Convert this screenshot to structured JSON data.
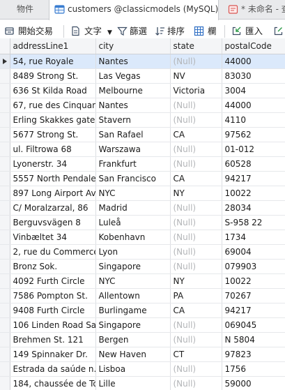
{
  "tabs": {
    "objects": "物件",
    "active": "customers @classicmodels (MySQL) - ...",
    "query": "* 未命名 - 查"
  },
  "toolbar": {
    "begin_transaction": "開始交易",
    "text": "文字",
    "filter": "篩選",
    "sort": "排序",
    "columns": "欄",
    "import": "匯入"
  },
  "table": {
    "columns": [
      "addressLine1",
      "city",
      "state",
      "postalCode"
    ],
    "rows": [
      [
        "54, rue Royale",
        "Nantes",
        "(Null)",
        "44000"
      ],
      [
        "8489 Strong St.",
        "Las Vegas",
        "NV",
        "83030"
      ],
      [
        "636 St Kilda Road",
        "Melbourne",
        "Victoria",
        "3004"
      ],
      [
        "67, rue des Cinquant",
        "Nantes",
        "(Null)",
        "44000"
      ],
      [
        "Erling Skakkes gate 7",
        "Stavern",
        "(Null)",
        "4110"
      ],
      [
        "5677 Strong St.",
        "San Rafael",
        "CA",
        "97562"
      ],
      [
        "ul. Filtrowa 68",
        "Warszawa",
        "(Null)",
        "01-012"
      ],
      [
        "Lyonerstr. 34",
        "Frankfurt",
        "(Null)",
        "60528"
      ],
      [
        "5557 North Pendale S",
        "San Francisco",
        "CA",
        "94217"
      ],
      [
        "897 Long Airport Ave",
        "NYC",
        "NY",
        "10022"
      ],
      [
        "C/ Moralzarzal, 86",
        "Madrid",
        "(Null)",
        "28034"
      ],
      [
        "Berguvsvägen  8",
        "Luleå",
        "(Null)",
        "S-958 22"
      ],
      [
        "Vinbæltet 34",
        "Kobenhavn",
        "(Null)",
        "1734"
      ],
      [
        "2, rue du Commerce",
        "Lyon",
        "(Null)",
        "69004"
      ],
      [
        "Bronz Sok.",
        "Singapore",
        "(Null)",
        "079903"
      ],
      [
        "4092 Furth Circle",
        "NYC",
        "NY",
        "10022"
      ],
      [
        "7586 Pompton St.",
        "Allentown",
        "PA",
        "70267"
      ],
      [
        "9408 Furth Circle",
        "Burlingame",
        "CA",
        "94217"
      ],
      [
        "106 Linden Road Sar",
        "Singapore",
        "(Null)",
        "069045"
      ],
      [
        "Brehmen St. 121",
        "Bergen",
        "(Null)",
        "N 5804"
      ],
      [
        "149 Spinnaker Dr.",
        "New Haven",
        "CT",
        "97823"
      ],
      [
        "Estrada da saúde n.",
        "Lisboa",
        "(Null)",
        "1756"
      ],
      [
        "184, chaussée de Tou",
        "Lille",
        "(Null)",
        "59000"
      ]
    ],
    "selected_row": 0
  }
}
